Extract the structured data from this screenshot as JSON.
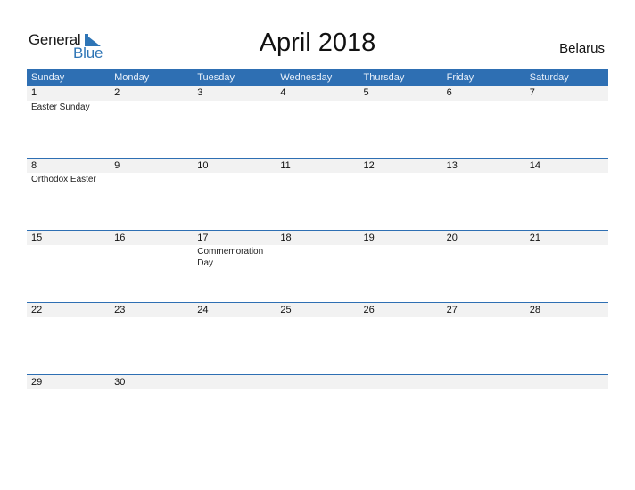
{
  "logo": {
    "word1": "General",
    "word2": "Blue"
  },
  "title": "April 2018",
  "country": "Belarus",
  "colors": {
    "accent": "#2e6fb3",
    "band": "#f2f2f2"
  },
  "weekdays": [
    "Sunday",
    "Monday",
    "Tuesday",
    "Wednesday",
    "Thursday",
    "Friday",
    "Saturday"
  ],
  "weeks": [
    {
      "days": [
        "1",
        "2",
        "3",
        "4",
        "5",
        "6",
        "7"
      ],
      "events": [
        "Easter Sunday",
        "",
        "",
        "",
        "",
        "",
        ""
      ]
    },
    {
      "days": [
        "8",
        "9",
        "10",
        "11",
        "12",
        "13",
        "14"
      ],
      "events": [
        "Orthodox Easter",
        "",
        "",
        "",
        "",
        "",
        ""
      ]
    },
    {
      "days": [
        "15",
        "16",
        "17",
        "18",
        "19",
        "20",
        "21"
      ],
      "events": [
        "",
        "",
        "Commemoration Day",
        "",
        "",
        "",
        ""
      ]
    },
    {
      "days": [
        "22",
        "23",
        "24",
        "25",
        "26",
        "27",
        "28"
      ],
      "events": [
        "",
        "",
        "",
        "",
        "",
        "",
        ""
      ]
    },
    {
      "days": [
        "29",
        "30",
        "",
        "",
        "",
        "",
        ""
      ],
      "events": [
        "",
        "",
        "",
        "",
        "",
        "",
        ""
      ]
    }
  ]
}
